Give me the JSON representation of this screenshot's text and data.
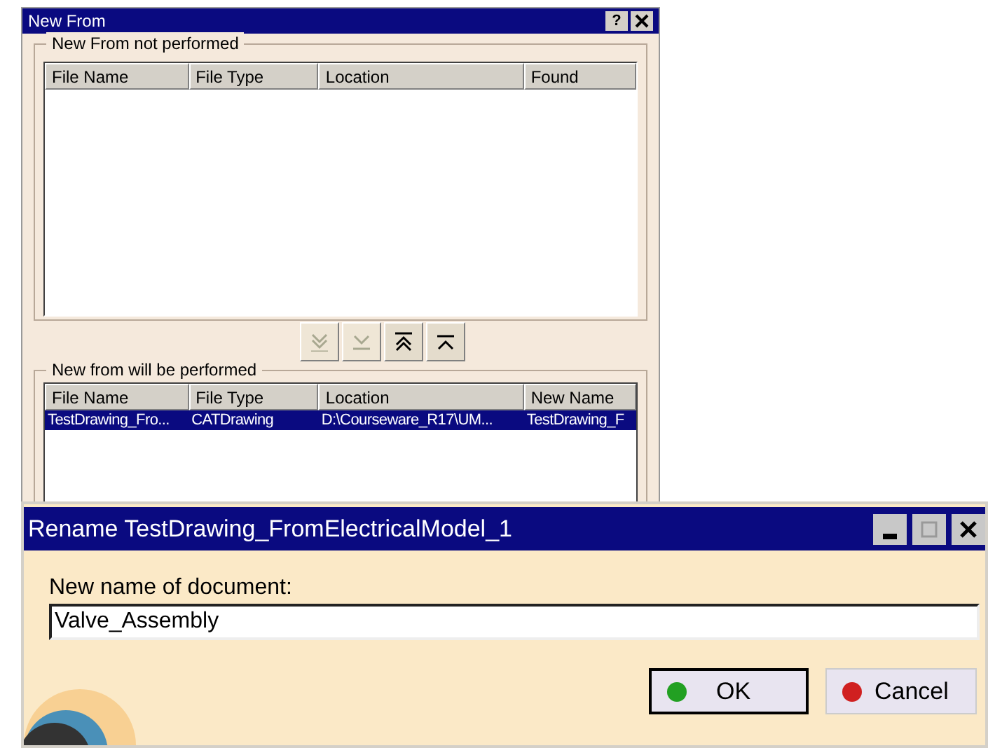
{
  "new_from": {
    "title": "New From",
    "help": "?",
    "not_performed": {
      "label": "New From not performed",
      "columns": [
        "File Name",
        "File Type",
        "Location",
        "Found"
      ]
    },
    "move_buttons": [
      {
        "kind": "all-down",
        "disabled": true
      },
      {
        "kind": "down",
        "disabled": true
      },
      {
        "kind": "all-up",
        "disabled": false
      },
      {
        "kind": "up",
        "disabled": false
      }
    ],
    "performed": {
      "label": "New from will be performed",
      "columns": [
        "File Name",
        "File Type",
        "Location",
        "New Name"
      ],
      "rows": [
        {
          "cells": [
            "TestDrawing_Fro...",
            "CATDrawing",
            "D:\\Courseware_R17\\UM...",
            "TestDrawing_F"
          ],
          "selected": true
        }
      ]
    }
  },
  "rename": {
    "title": "Rename TestDrawing_FromElectricalModel_1",
    "field_label": "New name of document:",
    "value": "Valve_Assembly",
    "buttons": [
      {
        "label": "OK",
        "kind": "ok",
        "default": true
      },
      {
        "label": "Cancel",
        "kind": "cancel",
        "default": false
      }
    ]
  }
}
